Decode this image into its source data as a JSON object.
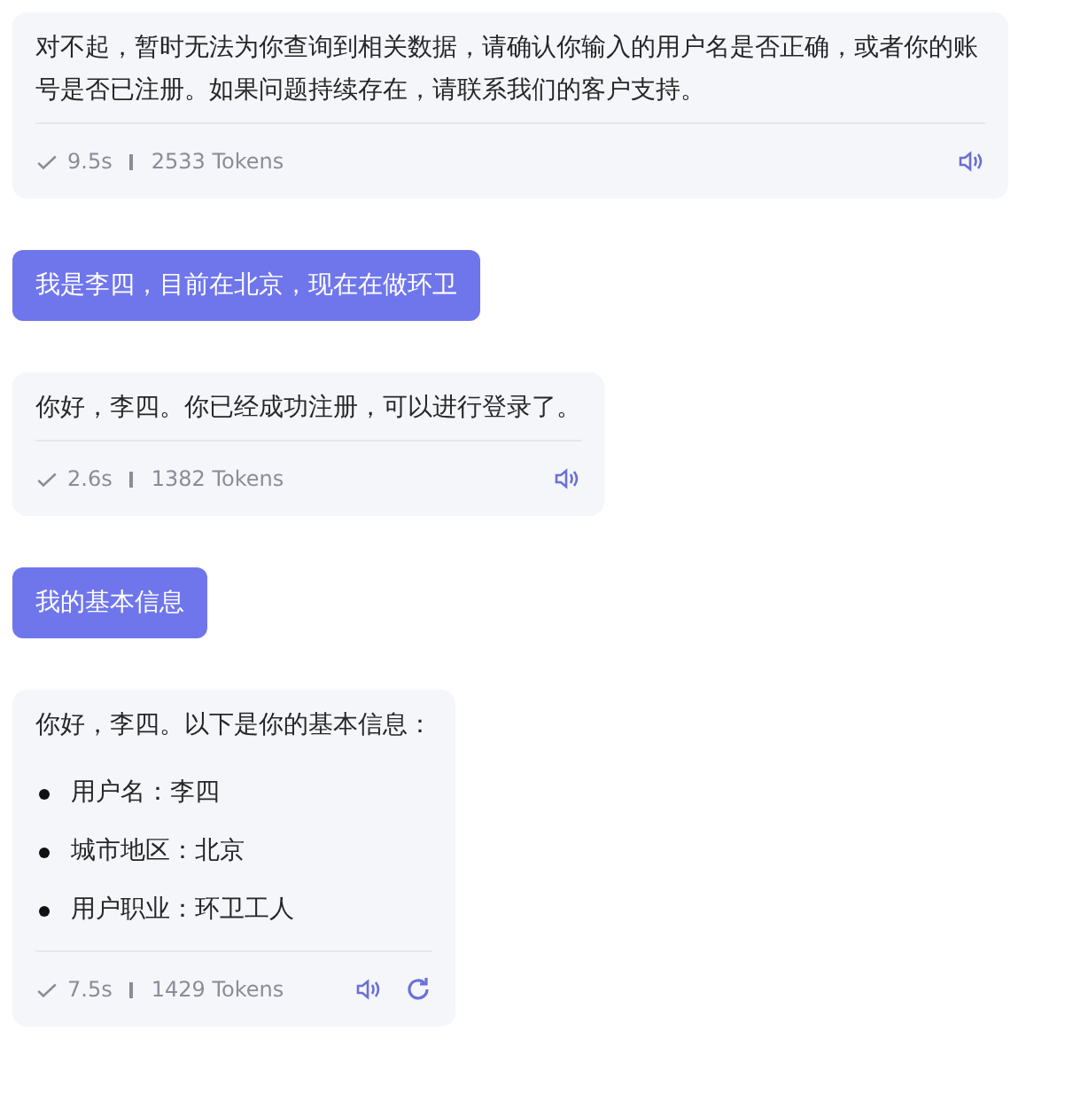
{
  "messages": [
    {
      "kind": "bot",
      "text": "对不起，暂时无法为你查询到相关数据，请确认你输入的用户名是否正确，或者你的账号是否已注册。如果问题持续存在，请联系我们的客户支持。",
      "time": "9.5s",
      "tokens": "2533 Tokens",
      "regenerate": false
    },
    {
      "kind": "user",
      "text": "我是李四，目前在北京，现在在做环卫"
    },
    {
      "kind": "bot",
      "text": "你好，李四。你已经成功注册，可以进行登录了。",
      "time": "2.6s",
      "tokens": "1382 Tokens",
      "regenerate": false
    },
    {
      "kind": "user",
      "text": "我的基本信息"
    },
    {
      "kind": "bot",
      "text": "你好，李四。以下是你的基本信息：",
      "items": [
        "用户名：李四",
        "城市地区：北京",
        "用户职业：环卫工人"
      ],
      "time": "7.5s",
      "tokens": "1429 Tokens",
      "regenerate": true
    }
  ]
}
